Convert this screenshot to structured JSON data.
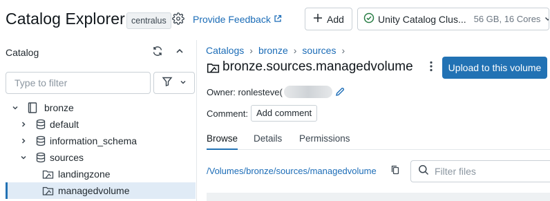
{
  "header": {
    "title": "Catalog Explorer",
    "region": "centralus",
    "feedback_label": "Provide Feedback",
    "add_label": "Add",
    "cluster_name": "Unity Catalog Clus...",
    "cluster_spec": "56 GB, 16 Cores",
    "icons": [
      "gear-icon",
      "external-link-icon",
      "plus-icon",
      "check-circle-icon",
      "chevron-down-icon"
    ]
  },
  "sidebar": {
    "title": "Catalog",
    "filter_placeholder": "Type to filter",
    "tree": [
      {
        "label": "bronze",
        "expanded": true,
        "icon": "catalog-icon"
      },
      {
        "label": "default",
        "expanded": false,
        "icon": "schema-icon"
      },
      {
        "label": "information_schema",
        "expanded": false,
        "icon": "schema-icon"
      },
      {
        "label": "sources",
        "expanded": true,
        "icon": "schema-icon"
      },
      {
        "label": "landingzone",
        "icon": "volume-icon"
      },
      {
        "label": "managedvolume",
        "icon": "volume-icon",
        "selected": true
      }
    ]
  },
  "main": {
    "breadcrumbs": [
      "Catalogs",
      "bronze",
      "sources"
    ],
    "title": "bronze.sources.managedvolume",
    "upload_label": "Upload to this volume",
    "owner_label": "Owner: ronlesteve(",
    "comment_label": "Comment:",
    "add_comment_label": "Add comment",
    "tabs": [
      "Browse",
      "Details",
      "Permissions"
    ],
    "active_tab": "Browse",
    "path": "/Volumes/bronze/sources/managedvolume",
    "filter_files_placeholder": "Filter files"
  },
  "colors": {
    "accent": "#2272b4",
    "link": "#1b6cb7",
    "success": "#277c43",
    "selected_row": "#e0ebf6"
  }
}
